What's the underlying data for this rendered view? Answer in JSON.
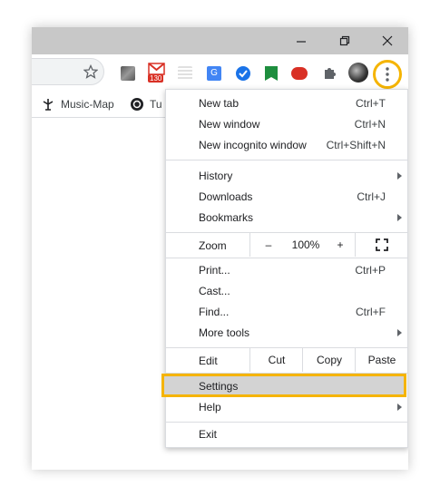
{
  "colors": {
    "accent_highlight": "#f5b400",
    "titlebar": "#c8c8c8",
    "menu_hover": "#d3d3d3"
  },
  "window_controls": {
    "minimize_icon": "minimize-icon",
    "restore_icon": "restore-icon",
    "close_icon": "close-icon"
  },
  "toolbar": {
    "bookmark_star_icon": "star-icon",
    "extensions": [
      {
        "name": "Gmail",
        "badge": "130"
      }
    ],
    "menu_button_icon": "kebab-menu-icon"
  },
  "bookmarks_bar": [
    {
      "label": "Music-Map"
    },
    {
      "label": "Tu"
    }
  ],
  "menu": {
    "new_tab": {
      "label": "New tab",
      "shortcut": "Ctrl+T"
    },
    "new_window": {
      "label": "New window",
      "shortcut": "Ctrl+N"
    },
    "new_incognito": {
      "label": "New incognito window",
      "shortcut": "Ctrl+Shift+N"
    },
    "history": {
      "label": "History"
    },
    "downloads": {
      "label": "Downloads",
      "shortcut": "Ctrl+J"
    },
    "bookmarks": {
      "label": "Bookmarks"
    },
    "zoom": {
      "label": "Zoom",
      "minus": "–",
      "value": "100%",
      "plus": "+"
    },
    "print": {
      "label": "Print...",
      "shortcut": "Ctrl+P"
    },
    "cast": {
      "label": "Cast..."
    },
    "find": {
      "label": "Find...",
      "shortcut": "Ctrl+F"
    },
    "more_tools": {
      "label": "More tools"
    },
    "edit": {
      "label": "Edit",
      "cut": "Cut",
      "copy": "Copy",
      "paste": "Paste"
    },
    "settings": {
      "label": "Settings"
    },
    "help": {
      "label": "Help"
    },
    "exit": {
      "label": "Exit"
    }
  }
}
